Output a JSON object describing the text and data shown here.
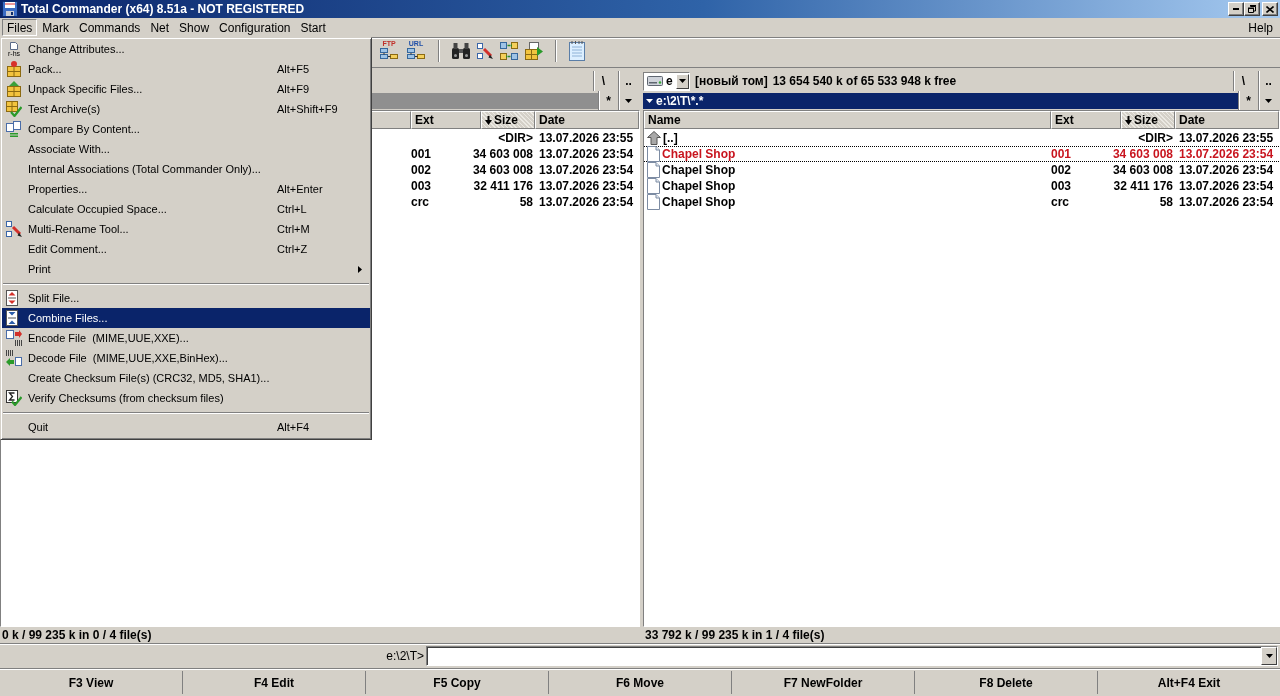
{
  "window": {
    "title": "Total Commander (x64) 8.51a - NOT REGISTERED"
  },
  "menu_bar": {
    "items": [
      {
        "label": "Files",
        "selected": true
      },
      {
        "label": "Mark",
        "selected": false
      },
      {
        "label": "Commands",
        "selected": false
      },
      {
        "label": "Net",
        "selected": false
      },
      {
        "label": "Show",
        "selected": false
      },
      {
        "label": "Configuration",
        "selected": false
      },
      {
        "label": "Start",
        "selected": false
      }
    ],
    "help": {
      "label": "Help",
      "selected": false
    }
  },
  "toolbar": {
    "network_buttons": [
      {
        "label": "FTP"
      },
      {
        "label": "URL"
      }
    ]
  },
  "files_menu": {
    "groups": [
      {
        "items": [
          {
            "kind": "command",
            "label": "Change Attributes...",
            "icon_label": "r-hs",
            "selected": false
          },
          {
            "kind": "command",
            "label": "Pack...",
            "shortcut": "Alt+F5",
            "selected": false
          },
          {
            "kind": "command",
            "label": "Unpack Specific Files...",
            "shortcut": "Alt+F9",
            "selected": false
          },
          {
            "kind": "command",
            "label": "Test Archive(s)",
            "shortcut": "Alt+Shift+F9",
            "selected": false
          },
          {
            "kind": "command",
            "label": "Compare By Content...",
            "selected": false
          },
          {
            "kind": "command",
            "label": "Associate With...",
            "selected": false
          },
          {
            "kind": "command",
            "label": "Internal Associations (Total Commander Only)...",
            "selected": false
          },
          {
            "kind": "command",
            "label": "Properties...",
            "shortcut": "Alt+Enter",
            "selected": false
          },
          {
            "kind": "command",
            "label": "Calculate Occupied Space...",
            "shortcut": "Ctrl+L",
            "selected": false
          },
          {
            "kind": "command",
            "label": "Multi-Rename Tool...",
            "shortcut": "Ctrl+M",
            "selected": false
          },
          {
            "kind": "command",
            "label": "Edit Comment...",
            "shortcut": "Ctrl+Z",
            "selected": false
          },
          {
            "kind": "submenu",
            "label": "Print",
            "selected": false
          }
        ]
      },
      {
        "items": [
          {
            "kind": "command",
            "label": "Split File...",
            "selected": false
          },
          {
            "kind": "command",
            "label": "Combine Files...",
            "selected": true
          },
          {
            "kind": "command",
            "label": "Encode File  (MIME,UUE,XXE)...",
            "selected": false
          },
          {
            "kind": "command",
            "label": "Decode File  (MIME,UUE,XXE,BinHex)...",
            "selected": false
          },
          {
            "kind": "command",
            "label": "Create Checksum File(s) (CRC32, MD5, SHA1)...",
            "selected": false
          },
          {
            "kind": "command",
            "label": "Verify Checksums (from checksum files)",
            "selected": false
          }
        ]
      },
      {
        "items": [
          {
            "kind": "command",
            "label": "Quit",
            "shortcut": "Alt+F4",
            "selected": false
          }
        ]
      }
    ]
  },
  "left_panel": {
    "active": false,
    "nav_buttons": [
      "\\",
      ".."
    ],
    "filter_button": "*",
    "columns": [
      {
        "kind": "ext",
        "label": "Ext",
        "sorted": false
      },
      {
        "kind": "size",
        "label": "Size",
        "sorted": true
      },
      {
        "kind": "date",
        "label": "Date",
        "sorted": false
      }
    ],
    "rows": [
      {
        "size": "<DIR>",
        "date": "13.07.2026 23:55",
        "selected": false
      },
      {
        "ext": "001",
        "size": "34 603 008",
        "date": "13.07.2026 23:54",
        "selected": false
      },
      {
        "ext": "002",
        "size": "34 603 008",
        "date": "13.07.2026 23:54",
        "selected": false
      },
      {
        "ext": "003",
        "size": "32 411 176",
        "date": "13.07.2026 23:54",
        "selected": false
      },
      {
        "ext": "crc",
        "size": "58",
        "date": "13.07.2026 23:54",
        "selected": false
      }
    ],
    "status": "0 k / 99 235 k in 0 / 4 file(s)"
  },
  "right_panel": {
    "active": true,
    "drive": "e",
    "volume": "[новый том]",
    "free_space": "13 654 540 k of 65 533 948 k free",
    "nav_buttons": [
      "\\",
      ".."
    ],
    "path": "e:\\2\\T\\*.*",
    "filter_button": "*",
    "columns": [
      {
        "kind": "name",
        "label": "Name",
        "sorted": false
      },
      {
        "kind": "ext",
        "label": "Ext",
        "sorted": false
      },
      {
        "kind": "size",
        "label": "Size",
        "sorted": true
      },
      {
        "kind": "date",
        "label": "Date",
        "sorted": false
      }
    ],
    "rows": [
      {
        "kind": "up",
        "name": "[..]",
        "size": "<DIR>",
        "date": "13.07.2026 23:55",
        "selected": false,
        "cursor": false
      },
      {
        "kind": "file",
        "name": "Chapel Shop",
        "ext": "001",
        "size": "34 603 008",
        "date": "13.07.2026 23:54",
        "selected": true,
        "cursor": true
      },
      {
        "kind": "file",
        "name": "Chapel Shop",
        "ext": "002",
        "size": "34 603 008",
        "date": "13.07.2026 23:54",
        "selected": false,
        "cursor": false
      },
      {
        "kind": "file",
        "name": "Chapel Shop",
        "ext": "003",
        "size": "32 411 176",
        "date": "13.07.2026 23:54",
        "selected": false,
        "cursor": false
      },
      {
        "kind": "file",
        "name": "Chapel Shop",
        "ext": "crc",
        "size": "58",
        "date": "13.07.2026 23:54",
        "selected": false,
        "cursor": false
      }
    ],
    "status": "33 792 k / 99 235 k in 1 / 4 file(s)"
  },
  "command_line": {
    "prompt": "e:\\2\\T>"
  },
  "function_keys": [
    "F3 View",
    "F4 Edit",
    "F5 Copy",
    "F6 Move",
    "F7 NewFolder",
    "F8 Delete",
    "Alt+F4 Exit"
  ]
}
